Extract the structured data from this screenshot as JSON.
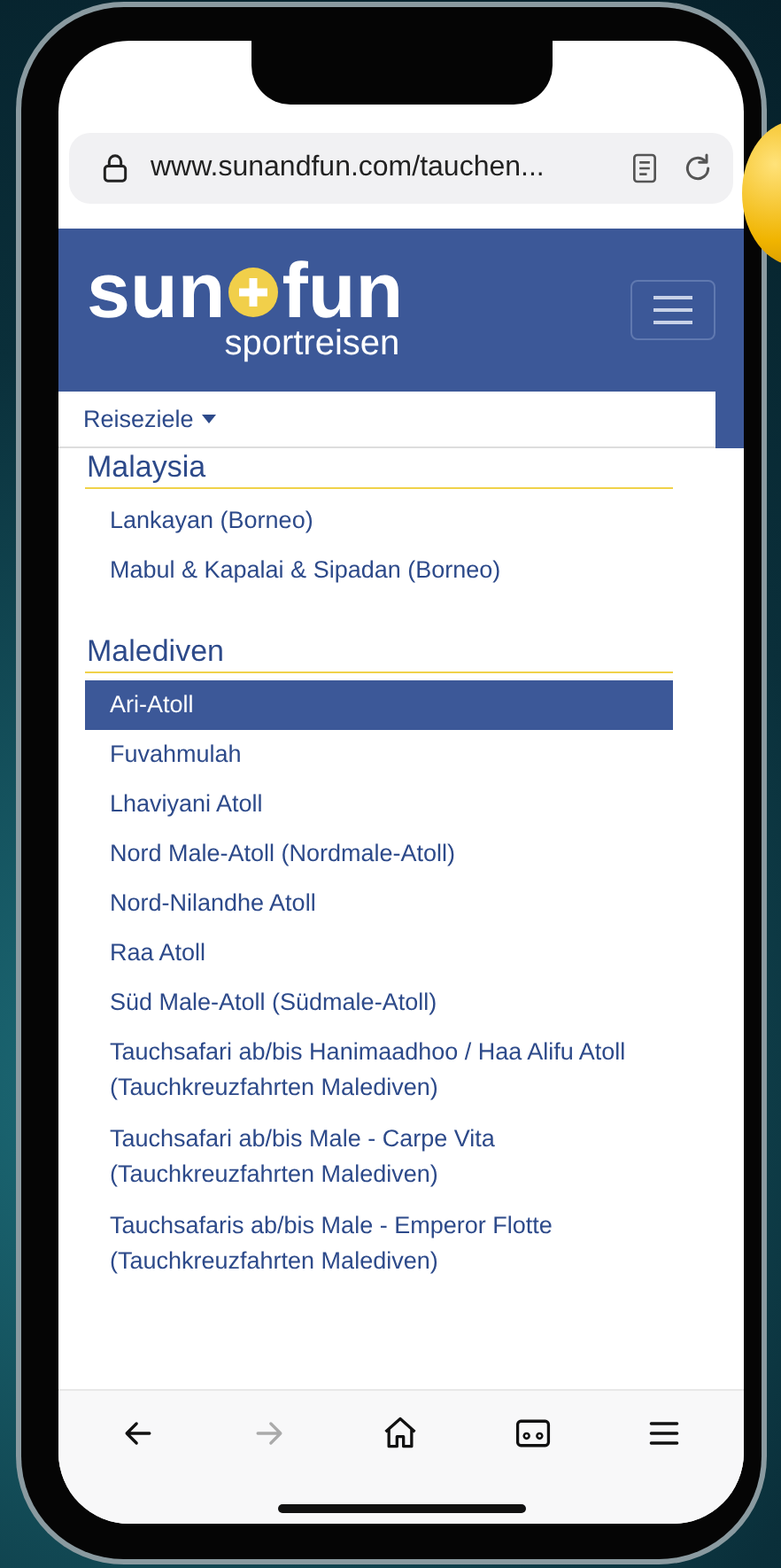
{
  "browser": {
    "url": "www.sunandfun.com/tauchen..."
  },
  "logo": {
    "left": "sun",
    "right": "fun",
    "tagline": "sportreisen"
  },
  "nav": {
    "label": "Reiseziele",
    "expanded": true
  },
  "groups": [
    {
      "heading": "Malaysia",
      "items": [
        {
          "label": "Lankayan (Borneo)",
          "selected": false
        },
        {
          "label": "Mabul & Kapalai & Sipadan (Borneo)",
          "selected": false
        }
      ]
    },
    {
      "heading": "Malediven",
      "items": [
        {
          "label": "Ari-Atoll",
          "selected": true
        },
        {
          "label": "Fuvahmulah",
          "selected": false
        },
        {
          "label": "Lhaviyani Atoll",
          "selected": false
        },
        {
          "label": "Nord Male-Atoll (Nordmale-Atoll)",
          "selected": false
        },
        {
          "label": "Nord-Nilandhe Atoll",
          "selected": false
        },
        {
          "label": "Raa Atoll",
          "selected": false
        },
        {
          "label": "Süd Male-Atoll (Südmale-Atoll)",
          "selected": false
        },
        {
          "label": "Tauchsafari ab/bis Hanimaadhoo / Haa Alifu Atoll (Tauchkreuzfahrten Malediven)",
          "selected": false
        },
        {
          "label": "Tauchsafari ab/bis Male - Carpe Vita (Tauchkreuzfahrten Malediven)",
          "selected": false
        },
        {
          "label": "Tauchsafaris ab/bis Male - Emperor Flotte (Tauchkreuzfahrten Malediven)",
          "selected": false
        }
      ]
    }
  ],
  "toolbar": [
    {
      "kind": "back",
      "disabled": false
    },
    {
      "kind": "forward",
      "disabled": true
    },
    {
      "kind": "home",
      "disabled": false
    },
    {
      "kind": "tabs",
      "disabled": false
    },
    {
      "kind": "menu",
      "disabled": false
    }
  ]
}
